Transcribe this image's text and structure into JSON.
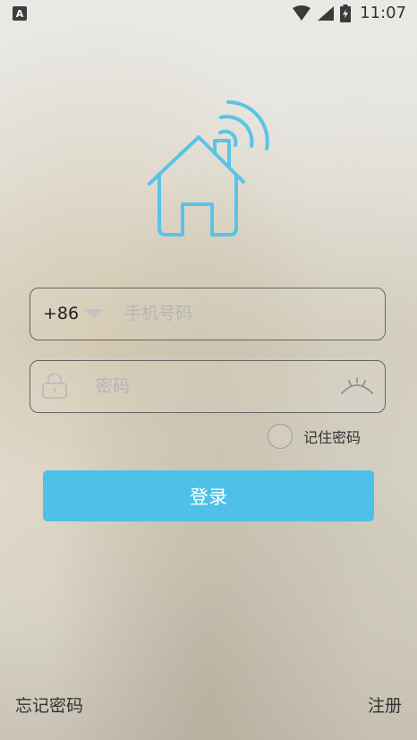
{
  "status_bar": {
    "app_icon_letter": "A",
    "time": "11:07",
    "icons": [
      "wifi-icon",
      "signal-icon",
      "battery-charging-icon"
    ]
  },
  "logo": {
    "icon": "smart-home-wifi-icon",
    "color": "#5bc3e6"
  },
  "login_form": {
    "country_code": "+86",
    "phone_placeholder": "手机号码",
    "password_placeholder": "密码",
    "remember_label": "记住密码",
    "remember_checked": false,
    "login_button": "登录"
  },
  "footer": {
    "forgot_password": "忘记密码",
    "register": "注册"
  },
  "colors": {
    "accent": "#4fc0e8",
    "field_border": "#666666"
  }
}
